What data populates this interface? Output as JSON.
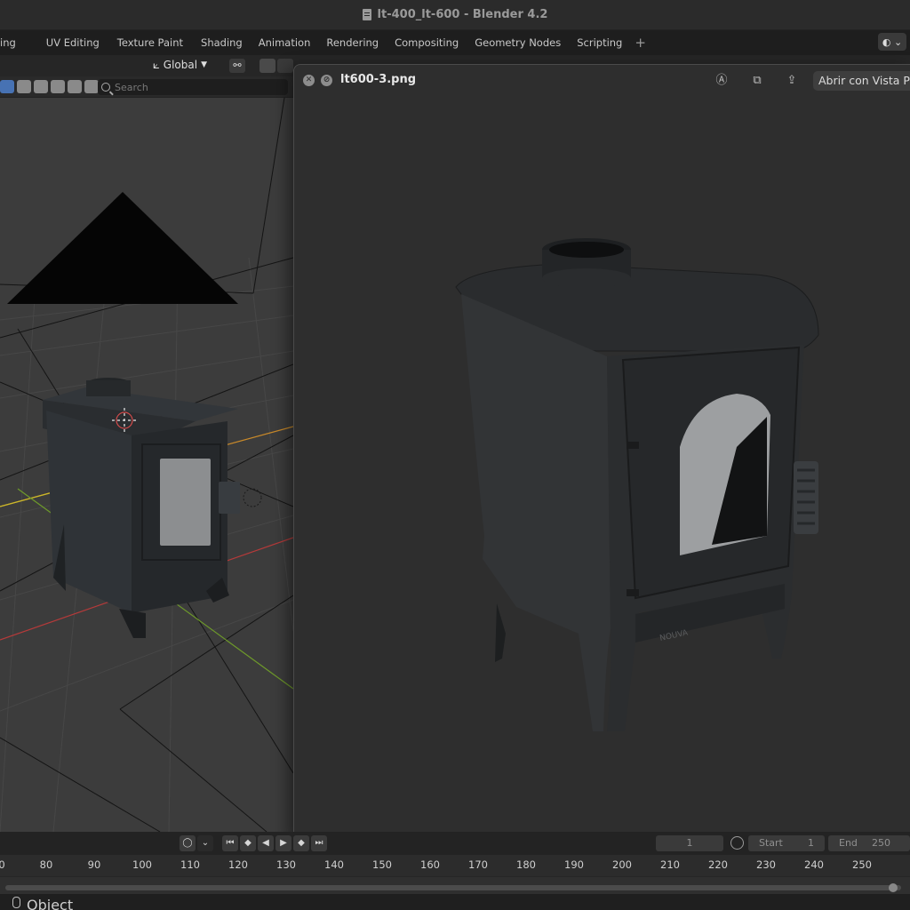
{
  "window": {
    "title": "lt-400_lt-600 - Blender 4.2"
  },
  "workspace_tabs": [
    "ing",
    "UV Editing",
    "Texture Paint",
    "Shading",
    "Animation",
    "Rendering",
    "Compositing",
    "Geometry Nodes",
    "Scripting"
  ],
  "workspace_add_label": "+",
  "viewport_header": {
    "transform_orientation": "Global",
    "search_placeholder": "Search",
    "snap_value": "0"
  },
  "preview": {
    "filename": "lt600-3.png",
    "open_with_label": "Abrir con Vista P",
    "product_mark": "NOUVA"
  },
  "timeline": {
    "current_frame": "1",
    "start_label": "Start",
    "start_value": "1",
    "end_label": "End",
    "end_value": "250",
    "ruler": [
      "0",
      "80",
      "90",
      "100",
      "110",
      "120",
      "130",
      "140",
      "150",
      "160",
      "170",
      "180",
      "190",
      "200",
      "210",
      "220",
      "230",
      "240",
      "250"
    ]
  },
  "status_bar": {
    "mode_label": "Object"
  },
  "icons": {
    "close": "close-icon",
    "hide": "hide-icon",
    "markup": "markup-icon",
    "rotate": "rotate-icon",
    "share": "share-icon",
    "search": "search-icon"
  },
  "colors": {
    "accent": "#4772b3",
    "x_axis": "#b53a3a",
    "y_axis": "#6e9a2a",
    "light": "#c98a2a"
  }
}
